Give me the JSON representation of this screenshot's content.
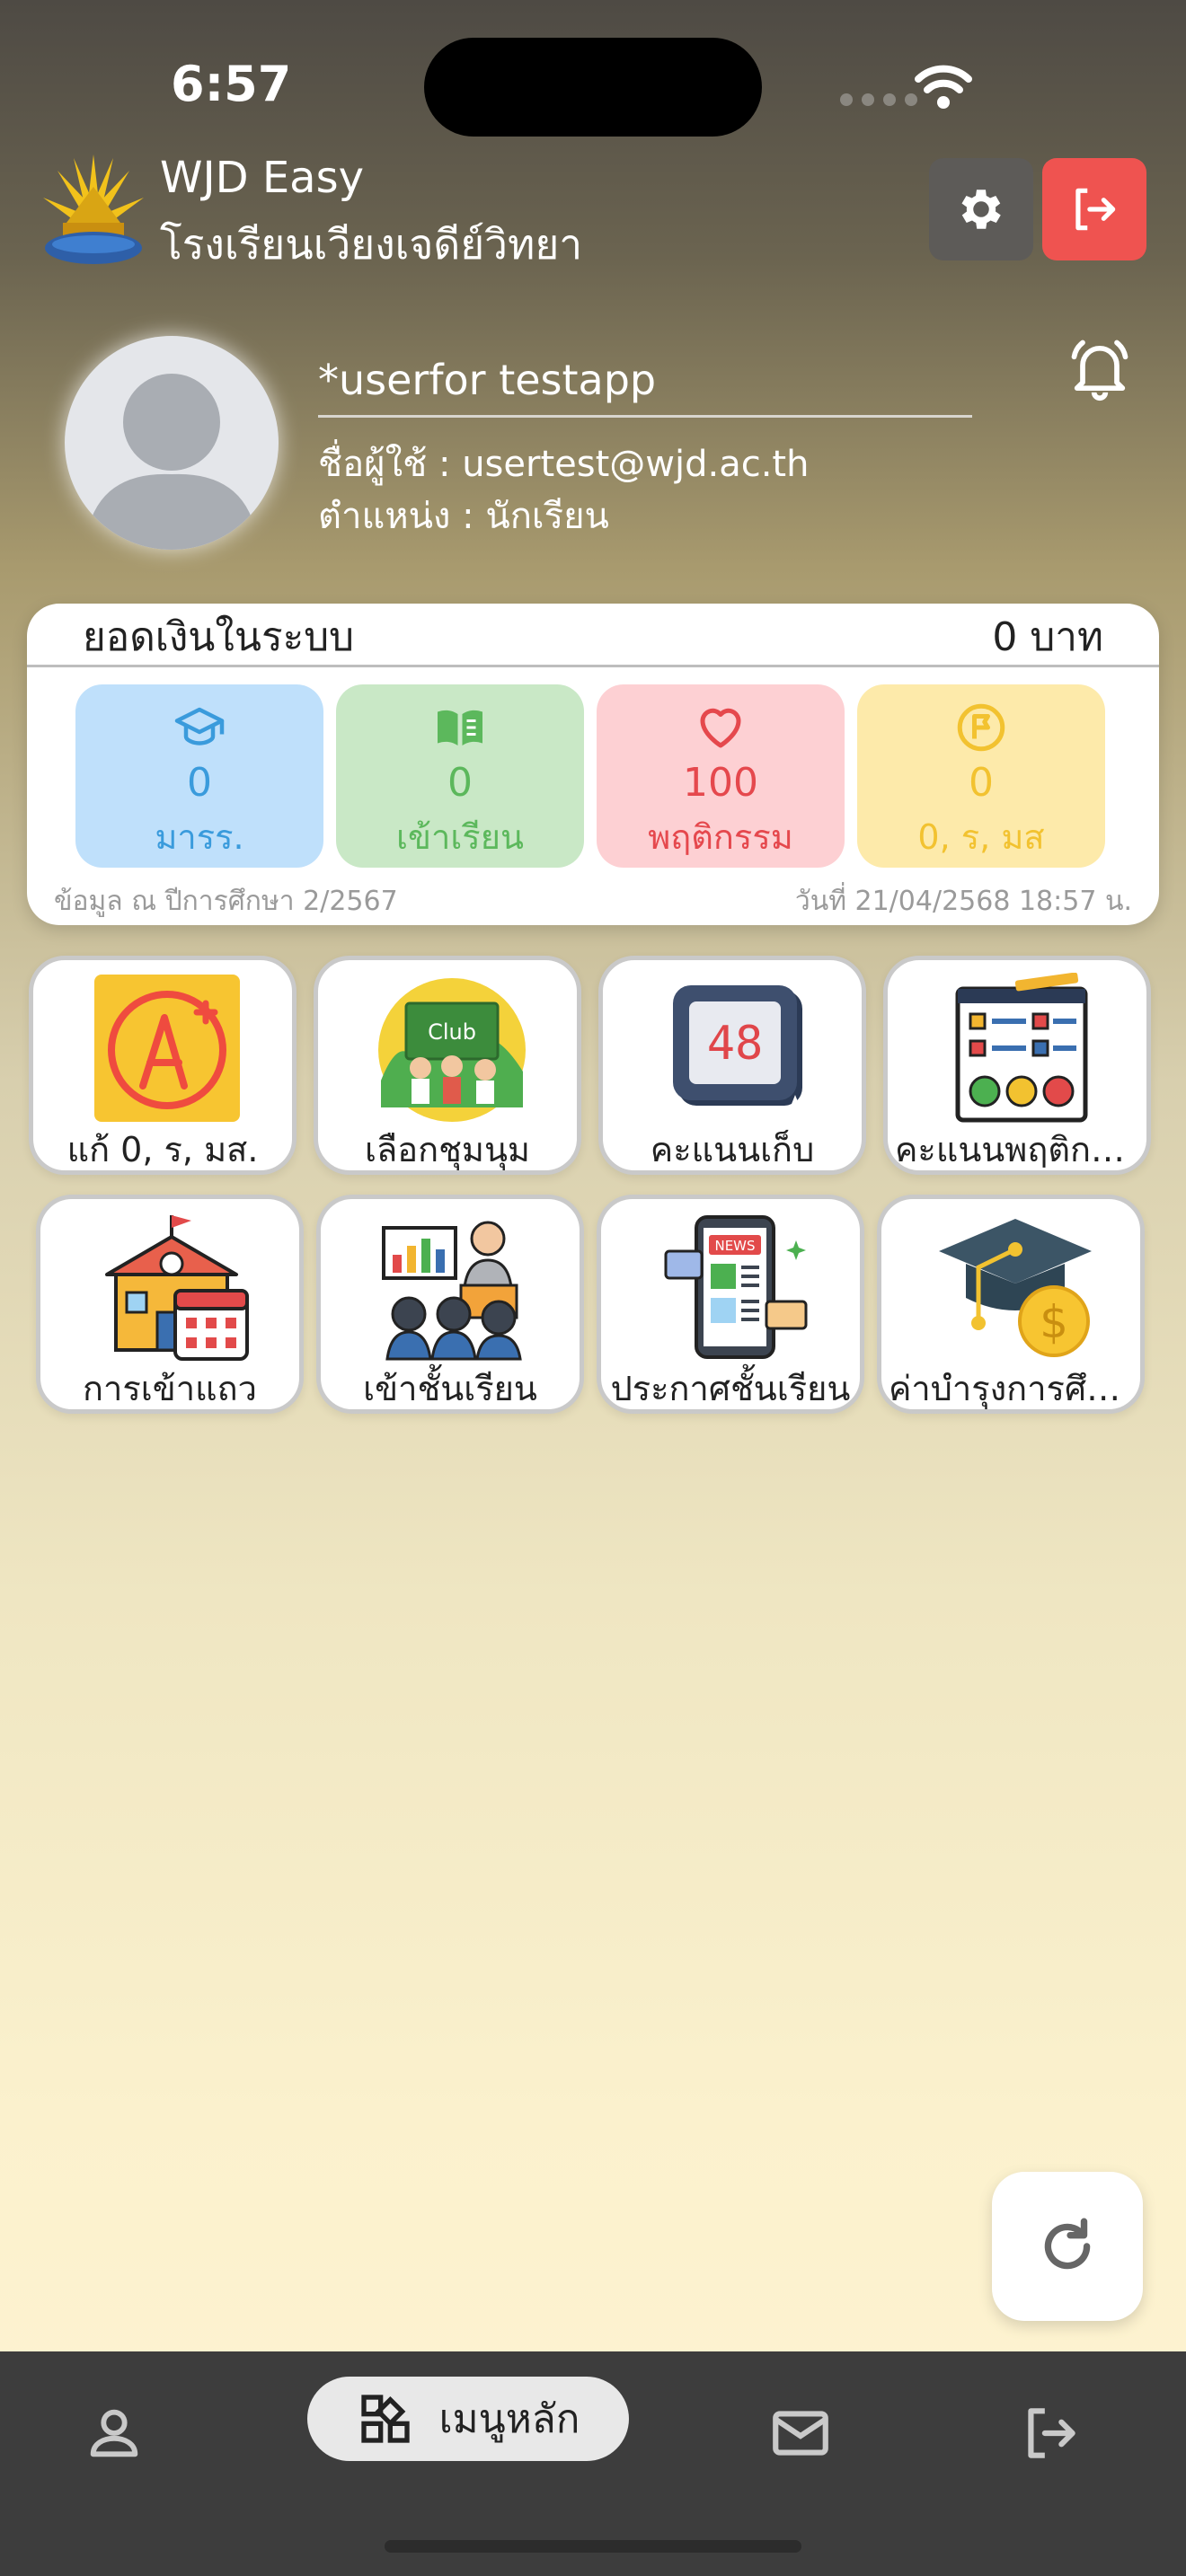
{
  "status": {
    "time": "6:57"
  },
  "header": {
    "app_title": "WJD Easy",
    "school_name": "โรงเรียนเวียงเจดีย์วิทยา"
  },
  "profile": {
    "name": "*userfor testapp",
    "email": "ชื่อผู้ใช้ : usertest@wjd.ac.th",
    "role": "ตำแหน่ง : นักเรียน"
  },
  "balance": {
    "label": "ยอดเงินในระบบ",
    "value": "0 บาท",
    "stats": [
      {
        "value": "0",
        "label": "มารร.",
        "icon": "graduation-cap-icon",
        "bg": "#bfe0fb",
        "color": "#3a9bdc"
      },
      {
        "value": "0",
        "label": "เข้าเรียน",
        "icon": "book-icon",
        "bg": "#c9e8c6",
        "color": "#5cb85c"
      },
      {
        "value": "100",
        "label": "พฤติกรรม",
        "icon": "heart-icon",
        "bg": "#fdd0d3",
        "color": "#e5484d"
      },
      {
        "value": "0",
        "label": "0, ร, มส",
        "icon": "flag-circle-icon",
        "bg": "#fdeaaa",
        "color": "#f2c230"
      }
    ],
    "footer_left": "ข้อมูล ณ ปีการศึกษา 2/2567",
    "footer_right": "วันที่ 21/04/2568 18:57 น."
  },
  "menu": [
    {
      "label": "แก้ 0, ร, มส.",
      "icon": "grade-a-plus-icon"
    },
    {
      "label": "เลือกชุมนุม",
      "icon": "club-icon"
    },
    {
      "label": "คะแนนเก็บ",
      "icon": "score-display-icon"
    },
    {
      "label": "คะแนนพฤติกรรม",
      "icon": "behavior-checklist-icon"
    },
    {
      "label": "การเข้าแถว",
      "icon": "school-calendar-icon"
    },
    {
      "label": "เข้าชั้นเรียน",
      "icon": "classroom-icon"
    },
    {
      "label": "ประกาศชั้นเรียน",
      "icon": "news-phone-icon"
    },
    {
      "label": "ค่าบำรุงการศึกษา",
      "icon": "tuition-fee-icon"
    }
  ],
  "nav": {
    "home_label": "เมนูหลัก"
  },
  "colors": {
    "logout": "#ef5350",
    "settings": "#5d5b58",
    "nav_bg": "#3d3d3d"
  }
}
